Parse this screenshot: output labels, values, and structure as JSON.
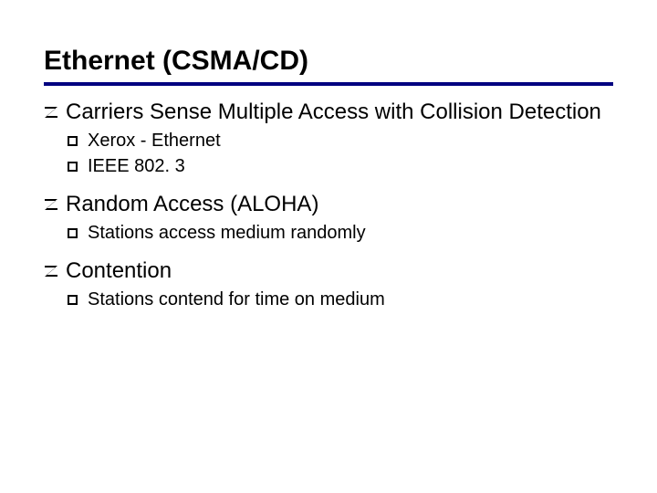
{
  "title": "Ethernet (CSMA/CD)",
  "items": [
    {
      "text": "Carriers Sense Multiple Access with Collision Detection",
      "sub": [
        {
          "text": "Xerox - Ethernet"
        },
        {
          "text": "IEEE 802. 3"
        }
      ]
    },
    {
      "text": "Random Access (ALOHA)",
      "sub": [
        {
          "text": " Stations access medium randomly"
        }
      ]
    },
    {
      "text": " Contention",
      "sub": [
        {
          "text": "Stations contend for time on medium"
        }
      ]
    }
  ]
}
